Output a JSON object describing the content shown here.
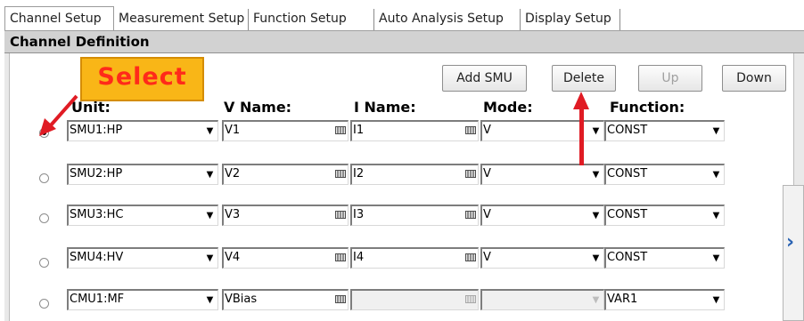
{
  "tabs": [
    {
      "label": "Channel Setup",
      "active": true
    },
    {
      "label": "Measurement Setup",
      "active": false
    },
    {
      "label": "Function Setup",
      "active": false
    },
    {
      "label": "Auto Analysis Setup",
      "active": false
    },
    {
      "label": "Display Setup",
      "active": false
    }
  ],
  "section": {
    "title": "Channel Definition"
  },
  "buttons": {
    "add_smu": "Add SMU",
    "delete": "Delete",
    "up": "Up",
    "down": "Down"
  },
  "columns": {
    "unit": "Unit:",
    "v_name": "V Name:",
    "i_name": "I Name:",
    "mode": "Mode:",
    "function": "Function:"
  },
  "callout": {
    "label": "Select"
  },
  "annotation_color": "#e01b24",
  "rows": [
    {
      "unit": "SMU1:HP",
      "v_name": "V1",
      "i_name": "I1",
      "mode": "V",
      "function": "CONST",
      "selected": true,
      "disabled_i": false
    },
    {
      "unit": "SMU2:HP",
      "v_name": "V2",
      "i_name": "I2",
      "mode": "V",
      "function": "CONST",
      "selected": false,
      "disabled_i": false
    },
    {
      "unit": "SMU3:HC",
      "v_name": "V3",
      "i_name": "I3",
      "mode": "V",
      "function": "CONST",
      "selected": false,
      "disabled_i": false
    },
    {
      "unit": "SMU4:HV",
      "v_name": "V4",
      "i_name": "I4",
      "mode": "V",
      "function": "CONST",
      "selected": false,
      "disabled_i": false
    },
    {
      "unit": "CMU1:MF",
      "v_name": "VBias",
      "i_name": "",
      "mode": "",
      "function": "VAR1",
      "selected": false,
      "disabled_i": true
    }
  ]
}
